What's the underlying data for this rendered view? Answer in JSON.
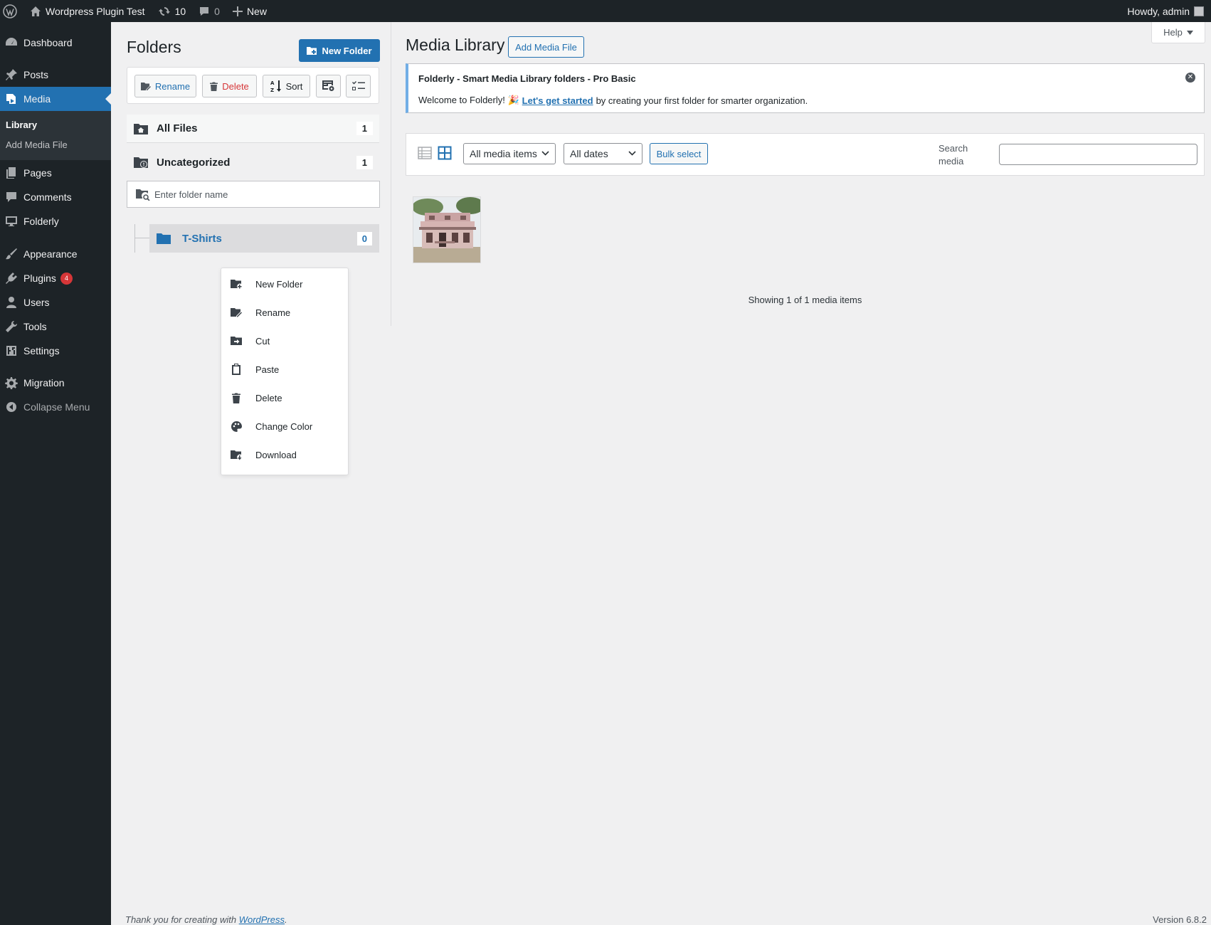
{
  "adminbar": {
    "site_name": "Wordpress Plugin Test",
    "updates_count": "10",
    "comments_count": "0",
    "new_label": "New",
    "howdy": "Howdy, admin"
  },
  "sidebar": {
    "items": [
      {
        "label": "Dashboard",
        "icon": "dashboard-icon"
      },
      {
        "label": "Posts",
        "icon": "pin-icon"
      },
      {
        "label": "Media",
        "icon": "media-icon"
      },
      {
        "label": "Pages",
        "icon": "pages-icon"
      },
      {
        "label": "Comments",
        "icon": "comment-icon"
      },
      {
        "label": "Folderly",
        "icon": "desktop-icon"
      },
      {
        "label": "Appearance",
        "icon": "brush-icon"
      },
      {
        "label": "Plugins",
        "icon": "plugin-icon",
        "badge": "4"
      },
      {
        "label": "Users",
        "icon": "user-icon"
      },
      {
        "label": "Tools",
        "icon": "wrench-icon"
      },
      {
        "label": "Settings",
        "icon": "settings-icon"
      },
      {
        "label": "Migration",
        "icon": "gear-icon"
      },
      {
        "label": "Collapse Menu",
        "icon": "collapse-icon"
      }
    ],
    "submenu": [
      "Library",
      "Add Media File"
    ]
  },
  "folders": {
    "title": "Folders",
    "new_folder_button": "New Folder",
    "toolbar": {
      "rename": "Rename",
      "delete": "Delete",
      "sort": "Sort"
    },
    "all_files": {
      "label": "All Files",
      "count": "1"
    },
    "uncategorized": {
      "label": "Uncategorized",
      "count": "1"
    },
    "search_placeholder": "Enter folder name",
    "tree": [
      {
        "label": "T-Shirts",
        "count": "0"
      }
    ]
  },
  "context_menu": {
    "items": [
      "New Folder",
      "Rename",
      "Cut",
      "Paste",
      "Delete",
      "Change Color",
      "Download"
    ]
  },
  "media": {
    "title": "Media Library",
    "add_button": "Add Media File",
    "help": "Help",
    "notice": {
      "title": "Folderly - Smart Media Library folders - Pro Basic",
      "text_before": "Welcome to Folderly! 🎉",
      "link": "Let's get started",
      "text_after": "by creating your first folder for smarter organization."
    },
    "filter_type": "All media items",
    "filter_date": "All dates",
    "bulk_select": "Bulk select",
    "search_label": "Search media",
    "showing": "Showing 1 of 1 media items"
  },
  "footer": {
    "thanks_prefix": "Thank you for creating with ",
    "thanks_link": "WordPress",
    "thanks_suffix": ".",
    "version": "Version 6.8.2"
  }
}
